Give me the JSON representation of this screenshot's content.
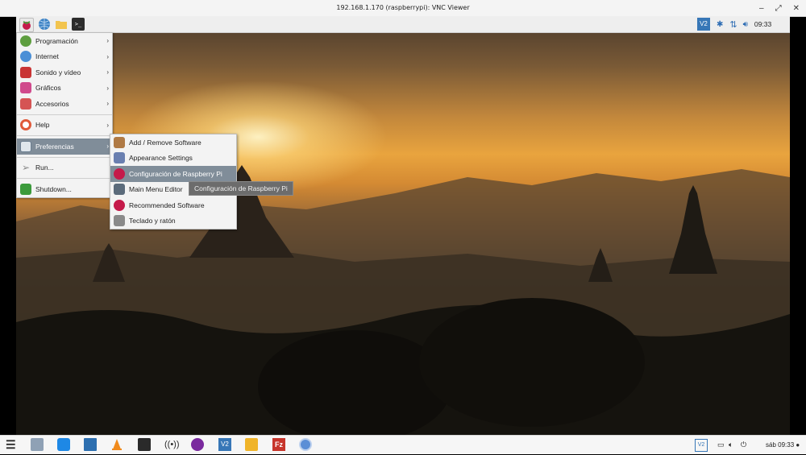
{
  "window": {
    "title": "192.168.1.170 (raspberrypi): VNC Viewer",
    "controls": [
      "–",
      "⤢",
      "✕"
    ]
  },
  "panel": {
    "launchers": [
      {
        "icon": "raspberry-icon",
        "color": "#c51a4a"
      },
      {
        "icon": "browser-globe-icon",
        "color": "#3b82c4"
      },
      {
        "icon": "folder-icon",
        "color": "#f2c44e"
      },
      {
        "icon": "terminal-icon",
        "color": "#2c2c2c"
      }
    ],
    "terminal_glyph": ">_",
    "tray": {
      "vnc_label": "V2",
      "clock": "09:33"
    }
  },
  "menu": {
    "items": [
      {
        "label": "Programación",
        "icon": "programming-icon",
        "color": "#5e9e3f",
        "arrow": "›"
      },
      {
        "label": "Internet",
        "icon": "internet-globe-icon",
        "color": "#4a8fd6",
        "arrow": "›"
      },
      {
        "label": "Sonido y vídeo",
        "icon": "sound-video-icon",
        "color": "#c93434",
        "arrow": "›"
      },
      {
        "label": "Gráficos",
        "icon": "graphics-icon",
        "color": "#d04a8c",
        "arrow": "›"
      },
      {
        "label": "Accesorios",
        "icon": "accessories-icon",
        "color": "#d55454",
        "arrow": "›"
      },
      {
        "label": "Help",
        "icon": "help-lifebuoy-icon",
        "color": "#e05a3a",
        "arrow": "›"
      },
      {
        "label": "Preferencias",
        "icon": "preferences-icon",
        "color": "#6a7d8f",
        "arrow": "›"
      },
      {
        "label": "Run...",
        "icon": "run-paper-plane-icon",
        "color": "#8a8a8a",
        "arrow": ""
      },
      {
        "label": "Shutdown...",
        "icon": "shutdown-icon",
        "color": "#3b9a3b",
        "arrow": ""
      }
    ],
    "submenu": [
      {
        "label": "Add / Remove Software",
        "icon": "package-icon",
        "color": "#b07a45"
      },
      {
        "label": "Appearance Settings",
        "icon": "appearance-icon",
        "color": "#6a7fb0"
      },
      {
        "label": "Configuración de Raspberry Pi",
        "icon": "raspberry-icon",
        "color": "#c51a4a"
      },
      {
        "label": "Main Menu Editor",
        "icon": "menu-editor-icon",
        "color": "#5b6b7b"
      },
      {
        "label": "Recommended Software",
        "icon": "raspberry-icon",
        "color": "#c51a4a"
      },
      {
        "label": "Teclado y ratón",
        "icon": "keyboard-mouse-icon",
        "color": "#8a8a8a"
      }
    ],
    "tooltip": "Configuración de Raspberry Pi"
  },
  "taskbar": {
    "apps": [
      {
        "icon": "zorin-menu-icon",
        "color": "#2a2a2a"
      },
      {
        "icon": "files-icon",
        "color": "#8fa1b5"
      },
      {
        "icon": "store-bag-icon",
        "color": "#1e88e5"
      },
      {
        "icon": "monitor-icon",
        "color": "#2d6fb0"
      },
      {
        "icon": "vlc-cone-icon",
        "color": "#f08a1c"
      },
      {
        "icon": "text-editor-icon",
        "color": "#2a2a2a"
      },
      {
        "icon": "broadcast-icon",
        "color": "#2a2a2a"
      },
      {
        "icon": "media-player-icon",
        "color": "#7a2a9e"
      },
      {
        "icon": "vnc-viewer-icon",
        "color": "#3777b7"
      },
      {
        "icon": "mail-icon",
        "color": "#f0b429"
      },
      {
        "icon": "filezilla-icon",
        "color": "#c7352b"
      },
      {
        "icon": "chromium-icon",
        "color": "#5b8ed6"
      }
    ],
    "tray_vnc_label": "V2",
    "clock": "sáb 09:33 ●"
  }
}
